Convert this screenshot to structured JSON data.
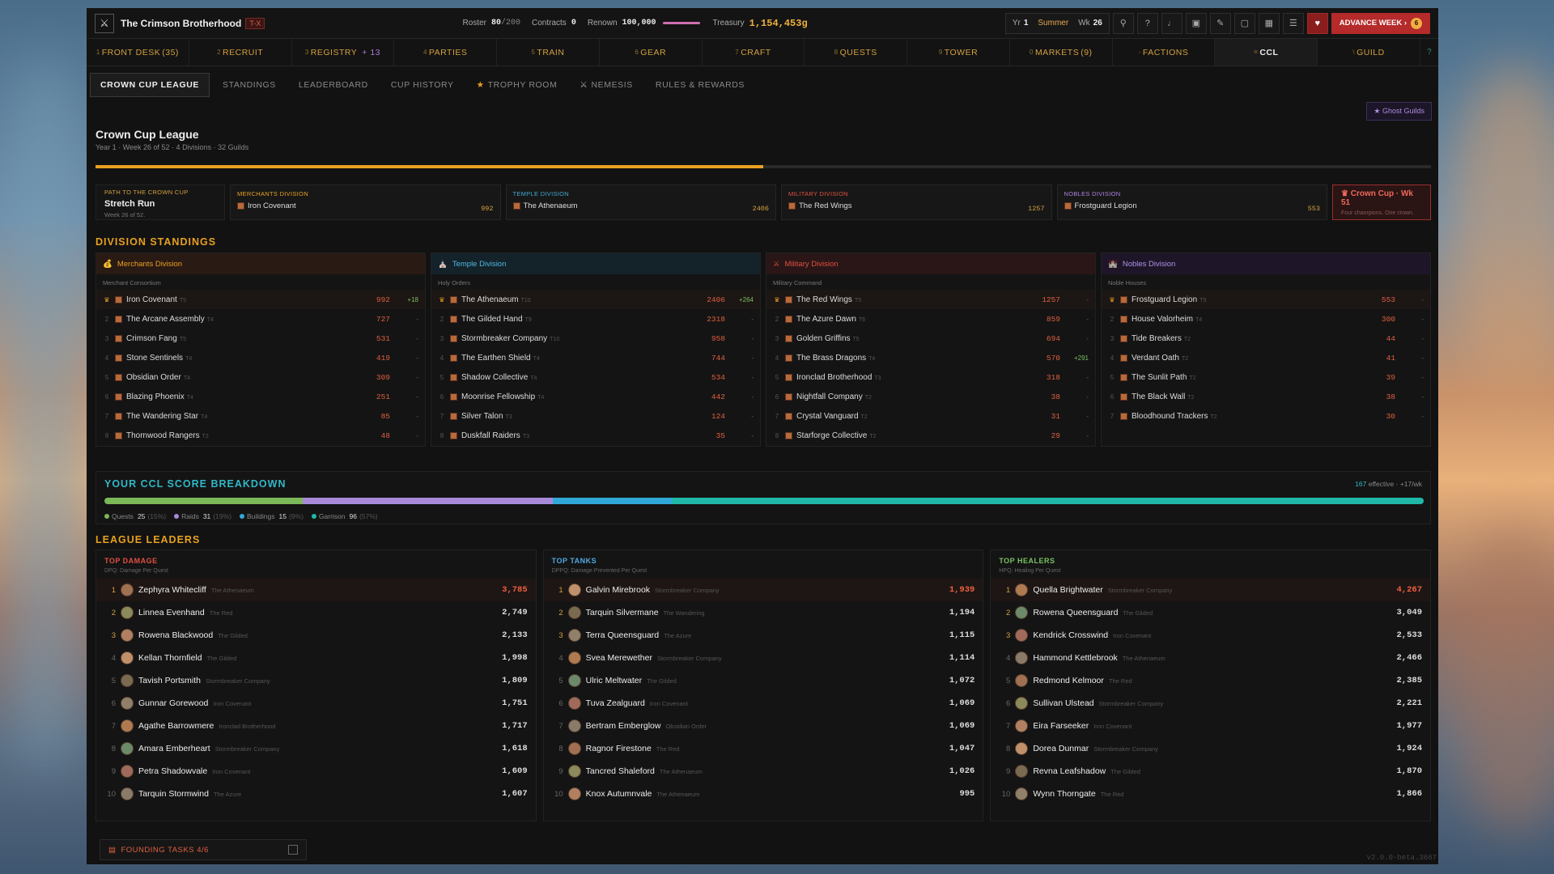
{
  "header": {
    "guild_name": "The Crimson Brotherhood",
    "guild_tag": "T-X",
    "roster_label": "Roster",
    "roster_value": "80",
    "roster_max": "/200",
    "contracts_label": "Contracts",
    "contracts_value": "0",
    "renown_label": "Renown",
    "renown_value": "100,000",
    "treasury_label": "Treasury",
    "treasury_value": "1,154,453g",
    "year_label": "Yr",
    "year_value": "1",
    "season": "Summer",
    "week_label": "Wk",
    "week_value": "26",
    "advance_label": "ADVANCE WEEK ›",
    "advance_badge": "6"
  },
  "nav": [
    {
      "key": "1",
      "label": "FRONT DESK",
      "count": "(35)",
      "plus": ""
    },
    {
      "key": "2",
      "label": "RECRUIT",
      "count": "",
      "plus": ""
    },
    {
      "key": "3",
      "label": "REGISTRY",
      "count": "",
      "plus": "+ 13"
    },
    {
      "key": "4",
      "label": "PARTIES",
      "count": "",
      "plus": ""
    },
    {
      "key": "5",
      "label": "TRAIN",
      "count": "",
      "plus": ""
    },
    {
      "key": "6",
      "label": "GEAR",
      "count": "",
      "plus": ""
    },
    {
      "key": "7",
      "label": "CRAFT",
      "count": "",
      "plus": ""
    },
    {
      "key": "8",
      "label": "QUESTS",
      "count": "",
      "plus": ""
    },
    {
      "key": "9",
      "label": "TOWER",
      "count": "",
      "plus": ""
    },
    {
      "key": "0",
      "label": "MARKETS",
      "count": "(9)",
      "plus": ""
    },
    {
      "key": "-",
      "label": "FACTIONS",
      "count": "",
      "plus": ""
    },
    {
      "key": "=",
      "label": "CCL",
      "count": "",
      "plus": ""
    },
    {
      "key": "\\",
      "label": "GUILD",
      "count": "",
      "plus": ""
    }
  ],
  "subtabs": [
    "CROWN CUP LEAGUE",
    "STANDINGS",
    "LEADERBOARD",
    "CUP HISTORY",
    "TROPHY ROOM",
    "NEMESIS",
    "RULES & REWARDS"
  ],
  "ghost_label": "Ghost Guilds",
  "league": {
    "title": "Crown Cup League",
    "subtitle": "Year 1 · Week 26 of 52 · 4 Divisions · 32 Guilds",
    "progress": 0.5
  },
  "path": {
    "label": "PATH TO THE CROWN CUP",
    "title": "Stretch Run",
    "week": "Week 26 of 52."
  },
  "division_leaders": [
    {
      "label": "MERCHANTS DIVISION",
      "leader": "Iron Covenant",
      "score": "992",
      "color": "#e8a020"
    },
    {
      "label": "TEMPLE DIVISION",
      "leader": "The Athenaeum",
      "score": "2406",
      "color": "#40a8d0"
    },
    {
      "label": "MILITARY DIVISION",
      "leader": "The Red Wings",
      "score": "1257",
      "color": "#e05040"
    },
    {
      "label": "NOBLES DIVISION",
      "leader": "Frostguard Legion",
      "score": "553",
      "color": "#b080e0"
    }
  ],
  "crown_cup": {
    "title": "Crown Cup · Wk 51",
    "sub": "Four champions. One crown."
  },
  "standings_title": "DIVISION STANDINGS",
  "divisions": [
    {
      "name": "Merchants Division",
      "sub": "Merchant Consortium",
      "color": "#e8a020",
      "bg": "#2a1a14",
      "icon": "💰",
      "rows": [
        [
          "Iron Covenant",
          "T5",
          "992",
          "+18"
        ],
        [
          "The Arcane Assembly",
          "T4",
          "727",
          "-"
        ],
        [
          "Crimson Fang",
          "T5",
          "531",
          "-"
        ],
        [
          "Stone Sentinels",
          "T4",
          "419",
          "-"
        ],
        [
          "Obsidian Order",
          "T4",
          "309",
          "-"
        ],
        [
          "Blazing Phoenix",
          "T4",
          "251",
          "-"
        ],
        [
          "The Wandering Star",
          "T4",
          "85",
          "-"
        ],
        [
          "Thornwood Rangers",
          "T2",
          "48",
          "-"
        ]
      ]
    },
    {
      "name": "Temple Division",
      "sub": "Holy Orders",
      "color": "#50b8e0",
      "bg": "#14222a",
      "icon": "⛪",
      "rows": [
        [
          "The Athenaeum",
          "T10",
          "2406",
          "+264"
        ],
        [
          "The Gilded Hand",
          "T9",
          "2318",
          "-"
        ],
        [
          "Stormbreaker Company",
          "T10",
          "958",
          "-"
        ],
        [
          "The Earthen Shield",
          "T4",
          "744",
          "-"
        ],
        [
          "Shadow Collective",
          "T4",
          "534",
          "-"
        ],
        [
          "Moonrise Fellowship",
          "T4",
          "442",
          "-"
        ],
        [
          "Silver Talon",
          "T3",
          "124",
          "-"
        ],
        [
          "Duskfall Raiders",
          "T3",
          "35",
          "-"
        ]
      ]
    },
    {
      "name": "Military Division",
      "sub": "Military Command",
      "color": "#e05040",
      "bg": "#2a1616",
      "icon": "⚔",
      "rows": [
        [
          "The Red Wings",
          "T5",
          "1257",
          "-"
        ],
        [
          "The Azure Dawn",
          "T6",
          "859",
          "-"
        ],
        [
          "Golden Griffins",
          "T5",
          "694",
          "-"
        ],
        [
          "The Brass Dragons",
          "T4",
          "570",
          "+291"
        ],
        [
          "Ironclad Brotherhood",
          "T3",
          "318",
          "-"
        ],
        [
          "Nightfall Company",
          "T2",
          "38",
          "-"
        ],
        [
          "Crystal Vanguard",
          "T2",
          "31",
          "-"
        ],
        [
          "Starforge Collective",
          "T2",
          "29",
          "-"
        ]
      ]
    },
    {
      "name": "Nobles Division",
      "sub": "Noble Houses",
      "color": "#b090e8",
      "bg": "#1e1628",
      "icon": "🏰",
      "rows": [
        [
          "Frostguard Legion",
          "T5",
          "553",
          "-"
        ],
        [
          "House Valorheim",
          "T4",
          "300",
          "-"
        ],
        [
          "Tide Breakers",
          "T2",
          "44",
          "-"
        ],
        [
          "Verdant Oath",
          "T2",
          "41",
          "-"
        ],
        [
          "The Sunlit Path",
          "T2",
          "39",
          "-"
        ],
        [
          "The Black Wall",
          "T2",
          "38",
          "-"
        ],
        [
          "Bloodhound Trackers",
          "T2",
          "30",
          "-"
        ]
      ]
    }
  ],
  "score": {
    "title": "YOUR CCL SCORE BREAKDOWN",
    "effective": "167",
    "effective_label": "effective",
    "rate": "+17/wk",
    "parts": [
      {
        "label": "Quests",
        "value": "25",
        "pct": "(15%)",
        "frac": 0.15,
        "color": "#7ab858"
      },
      {
        "label": "Raids",
        "value": "31",
        "pct": "(19%)",
        "frac": 0.19,
        "color": "#a88ad8"
      },
      {
        "label": "Buildings",
        "value": "15",
        "pct": "(9%)",
        "frac": 0.09,
        "color": "#30a8d8"
      },
      {
        "label": "Garrison",
        "value": "96",
        "pct": "(57%)",
        "frac": 0.57,
        "color": "#20b8a8"
      }
    ]
  },
  "leaders_title": "LEAGUE LEADERS",
  "leaders": [
    {
      "title": "TOP DAMAGE",
      "sub": "DPQ: Damage Per Quest",
      "color": "#e05040",
      "rows": [
        [
          "Zephyra Whitecliff",
          "The Athenaeum",
          "3,785"
        ],
        [
          "Linnea Evenhand",
          "The Red",
          "2,749"
        ],
        [
          "Rowena Blackwood",
          "The Gilded",
          "2,133"
        ],
        [
          "Kellan Thornfield",
          "The Gilded",
          "1,998"
        ],
        [
          "Tavish Portsmith",
          "Stormbreaker Company",
          "1,809"
        ],
        [
          "Gunnar Gorewood",
          "Iron Covenant",
          "1,751"
        ],
        [
          "Agathe Barrowmere",
          "Ironclad Brotherhood",
          "1,717"
        ],
        [
          "Amara Emberheart",
          "Stormbreaker Company",
          "1,618"
        ],
        [
          "Petra Shadowvale",
          "Iron Covenant",
          "1,609"
        ],
        [
          "Tarquin Stormwind",
          "The Azure",
          "1,607"
        ]
      ]
    },
    {
      "title": "TOP TANKS",
      "sub": "DPPQ: Damage Prevented Per Quest",
      "color": "#50a8e0",
      "rows": [
        [
          "Galvin Mirebrook",
          "Stormbreaker Company",
          "1,939"
        ],
        [
          "Tarquin Silvermane",
          "The Wandering",
          "1,194"
        ],
        [
          "Terra Queensguard",
          "The Azure",
          "1,115"
        ],
        [
          "Svea Merewether",
          "Stormbreaker Company",
          "1,114"
        ],
        [
          "Ulric Meltwater",
          "The Gilded",
          "1,072"
        ],
        [
          "Tuva Zealguard",
          "Iron Covenant",
          "1,069"
        ],
        [
          "Bertram Emberglow",
          "Obsidian Order",
          "1,069"
        ],
        [
          "Ragnor Firestone",
          "The Red",
          "1,047"
        ],
        [
          "Tancred Shaleford",
          "The Athenaeum",
          "1,026"
        ],
        [
          "Knox Autumnvale",
          "The Athenaeum",
          "995"
        ]
      ]
    },
    {
      "title": "TOP HEALERS",
      "sub": "HPQ: Healing Per Quest",
      "color": "#7ac060",
      "rows": [
        [
          "Quella Brightwater",
          "Stormbreaker Company",
          "4,267"
        ],
        [
          "Rowena Queensguard",
          "The Gilded",
          "3,049"
        ],
        [
          "Kendrick Crosswind",
          "Iron Covenant",
          "2,533"
        ],
        [
          "Hammond Kettlebrook",
          "The Athenaeum",
          "2,466"
        ],
        [
          "Redmond Kelmoor",
          "The Red",
          "2,385"
        ],
        [
          "Sullivan Ulstead",
          "Stormbreaker Company",
          "2,221"
        ],
        [
          "Eira Farseeker",
          "Iron Covenant",
          "1,977"
        ],
        [
          "Dorea Dunmar",
          "Stormbreaker Company",
          "1,924"
        ],
        [
          "Revna Leafshadow",
          "The Gilded",
          "1,870"
        ],
        [
          "Wynn Thorngate",
          "The Red",
          "1,866"
        ]
      ]
    }
  ],
  "founding": "FOUNDING TASKS 4/6",
  "version": "v2.0.0-beta.3667"
}
